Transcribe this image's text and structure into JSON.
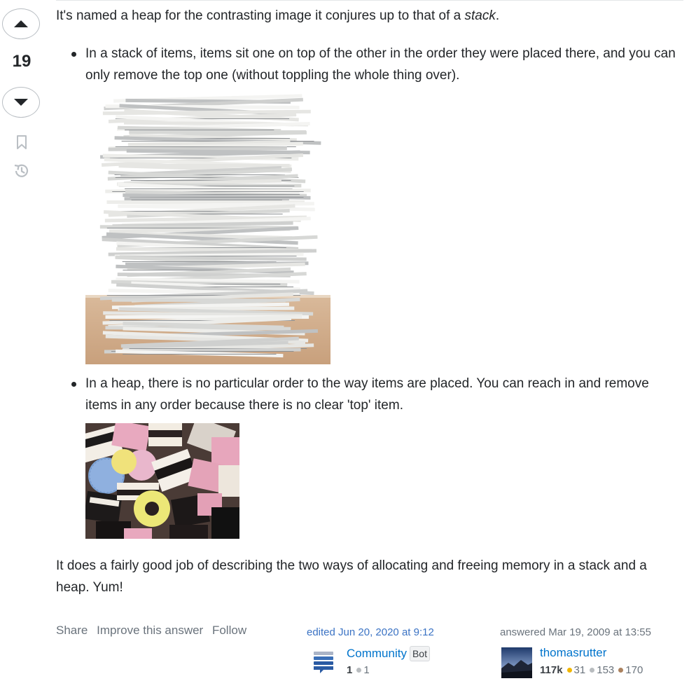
{
  "vote": {
    "count": "19"
  },
  "post": {
    "intro": "It's named a heap for the contrasting image it conjures up to that of a ",
    "intro_em": "stack",
    "intro_end": ".",
    "bullet1": "In a stack of items, items sit one on top of the other in the order they were placed there, and you can only remove the top one (without toppling the whole thing over).",
    "bullet2": "In a heap, there is no particular order to the way items are placed. You can reach in and remove items in any order because there is no clear 'top' item.",
    "closing": "It does a fairly good job of describing the two ways of allocating and freeing memory in a stack and a heap. Yum!"
  },
  "menu": {
    "share": "Share",
    "improve": "Improve this answer",
    "follow": "Follow"
  },
  "edited": {
    "action": "edited Jun 20, 2020 at 9:12",
    "user": "Community",
    "bot_tag": "Bot",
    "rep": "1",
    "silver": "1"
  },
  "answered": {
    "action": "answered Mar 19, 2009 at 13:55",
    "user": "thomasrutter",
    "rep": "117k",
    "gold": "31",
    "silver": "153",
    "bronze": "170"
  },
  "colors": {
    "link": "#0074cc",
    "gold": "#f1b600",
    "silver": "#9a9ea3",
    "bronze": "#ab825f"
  }
}
